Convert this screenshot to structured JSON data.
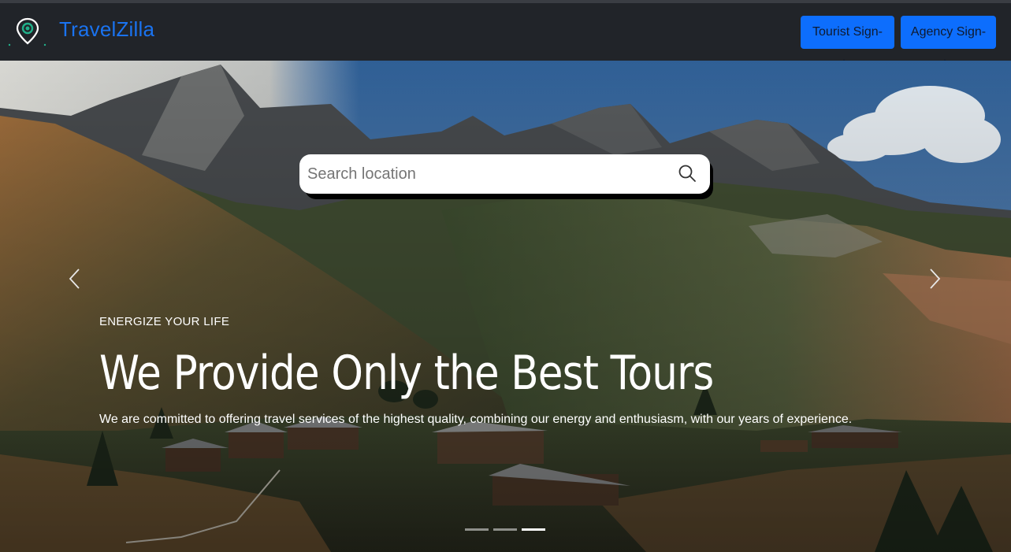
{
  "navbar": {
    "brand": "TravelZilla",
    "logo_icon": "map-pin-icon",
    "tourist_signin_label": "Tourist Sign-in",
    "agency_signin_label": "Agency Sign-in",
    "brand_color": "#1a73f0",
    "button_color": "#0d6efd",
    "background": "#212429"
  },
  "search": {
    "placeholder": "Search location",
    "value": "",
    "icon": "search-icon"
  },
  "hero": {
    "eyebrow": "ENERGIZE YOUR LIFE",
    "headline": "We Provide Only the Best Tours",
    "subtext": "We are committed to offering travel services of the highest quality, combining our energy and enthusiasm, with our years of experience.",
    "prev_icon": "chevron-left-icon",
    "next_icon": "chevron-right-icon",
    "slides_total": 3,
    "active_slide": 3
  }
}
